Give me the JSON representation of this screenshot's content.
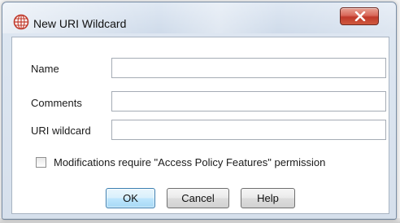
{
  "window": {
    "title": "New URI Wildcard",
    "icon": "globe-grid-icon",
    "close_icon": "close-x-icon"
  },
  "form": {
    "name_label": "Name",
    "name_value": "",
    "comments_label": "Comments",
    "comments_value": "",
    "uri_label": "URI wildcard",
    "uri_value": "",
    "checkbox_label": "Modifications require \"Access Policy Features\" permission",
    "checkbox_checked": false
  },
  "buttons": {
    "ok": "OK",
    "cancel": "Cancel",
    "help": "Help"
  },
  "colors": {
    "accent_red": "#c0392b",
    "default_button_border": "#3c7fb1"
  }
}
